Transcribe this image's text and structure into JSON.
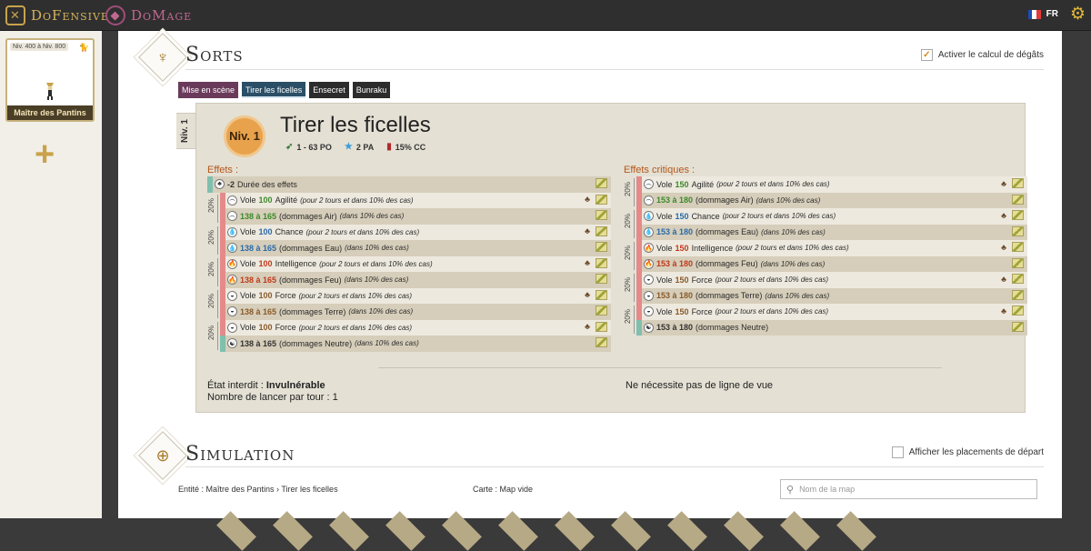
{
  "topbar": {
    "brands": [
      {
        "name": "DoFensive",
        "icon": "shield-swords-icon"
      },
      {
        "name": "DoMage",
        "icon": "sorcerer-hat-icon"
      }
    ],
    "lang": "FR",
    "flag_colors": [
      "#1f4bb5",
      "#ffffff",
      "#e23b3b"
    ],
    "settings_icon": "gear-icon"
  },
  "sidebar": {
    "entity": {
      "level_range": "Niv. 400 à Niv. 800",
      "name": "Maître des Pantins",
      "corner_icon": "cat-icon"
    },
    "add_icon": "plus-icon"
  },
  "spells_section": {
    "title": "Sorts",
    "icon": "puppet-master-icon",
    "damage_toggle": {
      "label": "Activer le calcul de dégâts",
      "checked": true
    },
    "tabs": [
      {
        "label": "Mise en scène",
        "active": false
      },
      {
        "label": "Tirer les ficelles",
        "active": true
      },
      {
        "label": "Ensecret",
        "active": false
      },
      {
        "label": "Bunraku",
        "active": false
      }
    ],
    "level_tab": "Niv. 1",
    "spell": {
      "level_badge": "Niv. 1",
      "name": "Tirer les ficelles",
      "range": "1 - 63 PO",
      "ap": "2 PA",
      "crit": "15% CC"
    },
    "effects_title": "Effets :",
    "critical_title": "Effets critiques :",
    "chance_label": "20%",
    "effects": [
      {
        "value": "-2",
        "text": "Durée des effets",
        "note": "",
        "icon": "duration-icon",
        "element": "neutral",
        "value_color": "#333"
      },
      {
        "prefix": "Vole",
        "value": "100",
        "text": "Agilité",
        "note": "(pour 2 tours et dans 10% des cas)",
        "icon": "air-icon",
        "element": "air",
        "value_color": "#3b8a2a"
      },
      {
        "value": "138 à 165",
        "text": "(dommages Air)",
        "note": "(dans 10% des cas)",
        "icon": "air-icon",
        "element": "air",
        "value_color": "#3b8a2a"
      },
      {
        "prefix": "Vole",
        "value": "100",
        "text": "Chance",
        "note": "(pour 2 tours et dans 10% des cas)",
        "icon": "water-icon",
        "element": "water",
        "value_color": "#2a6aa8"
      },
      {
        "value": "138 à 165",
        "text": "(dommages Eau)",
        "note": "(dans 10% des cas)",
        "icon": "water-icon",
        "element": "water",
        "value_color": "#2a6aa8"
      },
      {
        "prefix": "Vole",
        "value": "100",
        "text": "Intelligence",
        "note": "(pour 2 tours et dans 10% des cas)",
        "icon": "fire-icon",
        "element": "fire",
        "value_color": "#c0391b"
      },
      {
        "value": "138 à 165",
        "text": "(dommages Feu)",
        "note": "(dans 10% des cas)",
        "icon": "fire-icon",
        "element": "fire",
        "value_color": "#c0391b"
      },
      {
        "prefix": "Vole",
        "value": "100",
        "text": "Force",
        "note": "(pour 2 tours et dans 10% des cas)",
        "icon": "earth-icon",
        "element": "earth",
        "value_color": "#8a5a2a"
      },
      {
        "value": "138 à 165",
        "text": "(dommages Terre)",
        "note": "(dans 10% des cas)",
        "icon": "earth-icon",
        "element": "earth",
        "value_color": "#8a5a2a"
      },
      {
        "prefix": "Vole",
        "value": "100",
        "text": "Force",
        "note": "(pour 2 tours et dans 10% des cas)",
        "icon": "earth-icon",
        "element": "earth",
        "value_color": "#8a5a2a"
      },
      {
        "value": "138 à 165",
        "text": "(dommages Neutre)",
        "note": "(dans 10% des cas)",
        "icon": "neutral-icon",
        "element": "neutral",
        "value_color": "#333"
      }
    ],
    "critical_effects": [
      {
        "prefix": "Vole",
        "value": "150",
        "text": "Agilité",
        "note": "(pour 2 tours et dans 10% des cas)",
        "icon": "air-icon",
        "element": "air",
        "value_color": "#3b8a2a"
      },
      {
        "value": "153 à 180",
        "text": "(dommages Air)",
        "note": "(dans 10% des cas)",
        "icon": "air-icon",
        "element": "air",
        "value_color": "#3b8a2a"
      },
      {
        "prefix": "Vole",
        "value": "150",
        "text": "Chance",
        "note": "(pour 2 tours et dans 10% des cas)",
        "icon": "water-icon",
        "element": "water",
        "value_color": "#2a6aa8"
      },
      {
        "value": "153 à 180",
        "text": "(dommages Eau)",
        "note": "(dans 10% des cas)",
        "icon": "water-icon",
        "element": "water",
        "value_color": "#2a6aa8"
      },
      {
        "prefix": "Vole",
        "value": "150",
        "text": "Intelligence",
        "note": "(pour 2 tours et dans 10% des cas)",
        "icon": "fire-icon",
        "element": "fire",
        "value_color": "#c0391b"
      },
      {
        "value": "153 à 180",
        "text": "(dommages Feu)",
        "note": "(dans 10% des cas)",
        "icon": "fire-icon",
        "element": "fire",
        "value_color": "#c0391b"
      },
      {
        "prefix": "Vole",
        "value": "150",
        "text": "Force",
        "note": "(pour 2 tours et dans 10% des cas)",
        "icon": "earth-icon",
        "element": "earth",
        "value_color": "#8a5a2a"
      },
      {
        "value": "153 à 180",
        "text": "(dommages Terre)",
        "note": "(dans 10% des cas)",
        "icon": "earth-icon",
        "element": "earth",
        "value_color": "#8a5a2a"
      },
      {
        "prefix": "Vole",
        "value": "150",
        "text": "Force",
        "note": "(pour 2 tours et dans 10% des cas)",
        "icon": "earth-icon",
        "element": "earth",
        "value_color": "#8a5a2a"
      },
      {
        "value": "153 à 180",
        "text": "(dommages Neutre)",
        "note": "",
        "icon": "neutral-icon",
        "element": "neutral",
        "value_color": "#333"
      }
    ],
    "footer": {
      "forbidden_label": "État interdit :",
      "forbidden_value": "Invulnérable",
      "casts_label": "Nombre de lancer par tour : 1",
      "los": "Ne nécessite pas de ligne de vue"
    }
  },
  "simulation_section": {
    "title": "Simulation",
    "icon": "target-icon",
    "start_toggle": {
      "label": "Afficher les placements de départ",
      "checked": false
    },
    "entity_label": "Entité : Maître des Pantins › Tirer les ficelles",
    "map_label": "Carte : Map vide",
    "search_placeholder": "Nom de la map"
  },
  "element_colors": {
    "air": "#e58a8a",
    "water": "#e58a8a",
    "fire": "#e58a8a",
    "earth": "#e58a8a",
    "neutral": "#7fbfae"
  }
}
